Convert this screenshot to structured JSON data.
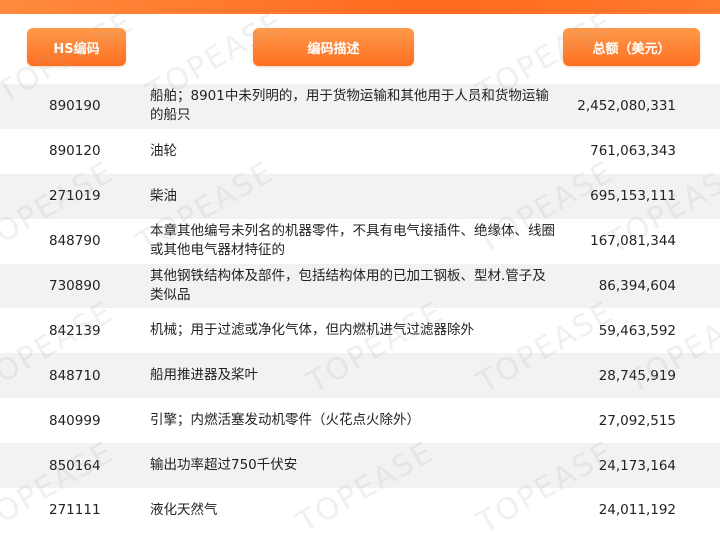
{
  "header": {
    "hs_label": "HS编码",
    "desc_label": "编码描述",
    "total_label": "总额（美元）"
  },
  "rows": [
    {
      "code": "890190",
      "desc": "船舶；8901中未列明的，用于货物运输和其他用于人员和货物运输的船只",
      "total": "2,452,080,331"
    },
    {
      "code": "890120",
      "desc": "油轮",
      "total": "761,063,343"
    },
    {
      "code": "271019",
      "desc": "柴油",
      "total": "695,153,111"
    },
    {
      "code": "848790",
      "desc": "本章其他编号未列名的机器零件，不具有电气接插件、绝缘体、线圈或其他电气器材特征的",
      "total": "167,081,344"
    },
    {
      "code": "730890",
      "desc": "其他钢铁结构体及部件，包括结构体用的已加工钢板、型材.管子及类似品",
      "total": "86,394,604"
    },
    {
      "code": "842139",
      "desc": "机械；用于过滤或净化气体，但内燃机进气过滤器除外",
      "total": "59,463,592"
    },
    {
      "code": "848710",
      "desc": "船用推进器及桨叶",
      "total": "28,745,919"
    },
    {
      "code": "840999",
      "desc": "引擎；内燃活塞发动机零件（火花点火除外）",
      "total": "27,092,515"
    },
    {
      "code": "850164",
      "desc": "输出功率超过750千伏安",
      "total": "24,173,164"
    },
    {
      "code": "271111",
      "desc": "液化天然气",
      "total": "24,011,192"
    }
  ],
  "watermark": {
    "text": "TOPEASE"
  },
  "colors": {
    "accent": "#ff7a2b",
    "row_alt": "#f2f2f2"
  }
}
